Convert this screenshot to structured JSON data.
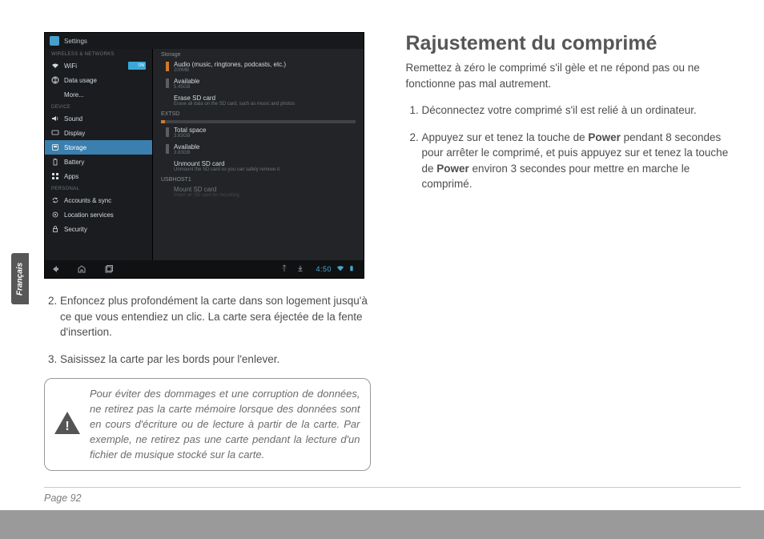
{
  "side_tab": "Français",
  "page_number": "Page 92",
  "left": {
    "steps": [
      "Enfoncez plus profondément la carte dans son logement jusqu'à ce que vous entendiez un clic. La carte sera éjectée de la fente d'insertion.",
      "Saisissez la carte par les bords pour l'enlever."
    ],
    "callout": "Pour éviter des dommages et une corruption de données, ne retirez pas la carte mémoire lorsque des données sont en cours d'écriture ou de lecture à partir de la carte. Par exemple, ne retirez pas une carte pendant la lecture d'un fichier de musique stocké sur la carte."
  },
  "right": {
    "title": "Rajustement du comprimé",
    "intro": "Remettez à zéro le comprimé s'il gèle et ne répond pas ou ne fonctionne pas mal autrement.",
    "steps": [
      {
        "pre": "Déconnectez votre comprimé s'il est relié à un ordinateur.",
        "bold": "",
        "post": ""
      },
      {
        "pre": "Appuyez sur et tenez la touche de ",
        "bold": "Power",
        "mid": " pendant 8 secondes pour arrêter le comprimé, et puis appuyez sur et tenez la touche de ",
        "bold2": "Power",
        "post": " environ 3 secondes pour mettre en marche le comprimé."
      }
    ]
  },
  "android": {
    "title": "Settings",
    "clock": "4:50",
    "wifi_toggle": "ON",
    "sections": {
      "wireless": "WIRELESS & NETWORKS",
      "device": "DEVICE",
      "personal": "PERSONAL"
    },
    "sidebar": [
      {
        "label": "WiFi",
        "icon": "wifi"
      },
      {
        "label": "Data usage",
        "icon": "data"
      },
      {
        "label": "More...",
        "icon": ""
      },
      {
        "label": "Sound",
        "icon": "sound"
      },
      {
        "label": "Display",
        "icon": "display"
      },
      {
        "label": "Storage",
        "icon": "storage"
      },
      {
        "label": "Battery",
        "icon": "battery"
      },
      {
        "label": "Apps",
        "icon": "apps"
      },
      {
        "label": "Accounts & sync",
        "icon": "sync"
      },
      {
        "label": "Location services",
        "icon": "location"
      },
      {
        "label": "Security",
        "icon": "security"
      }
    ],
    "content_header": "Storage",
    "groups": {
      "first_item": {
        "title": "Audio (music, ringtones, podcasts, etc.)",
        "sub": "200MB"
      },
      "available1": {
        "title": "Available",
        "sub": "5.45GB"
      },
      "erase": {
        "title": "Erase SD card",
        "sub": "Erase all data on the SD card, such as music and photos"
      },
      "extsd": "EXTSD",
      "total2": {
        "title": "Total space",
        "sub": "3.83GB"
      },
      "available2": {
        "title": "Available",
        "sub": "3.83GB"
      },
      "unmount": {
        "title": "Unmount SD card",
        "sub": "Unmount the SD card so you can safely remove it"
      },
      "usbhost": "USBHOST1",
      "mount": {
        "title": "Mount SD card",
        "sub": "Insert an SD card for mounting"
      }
    }
  }
}
